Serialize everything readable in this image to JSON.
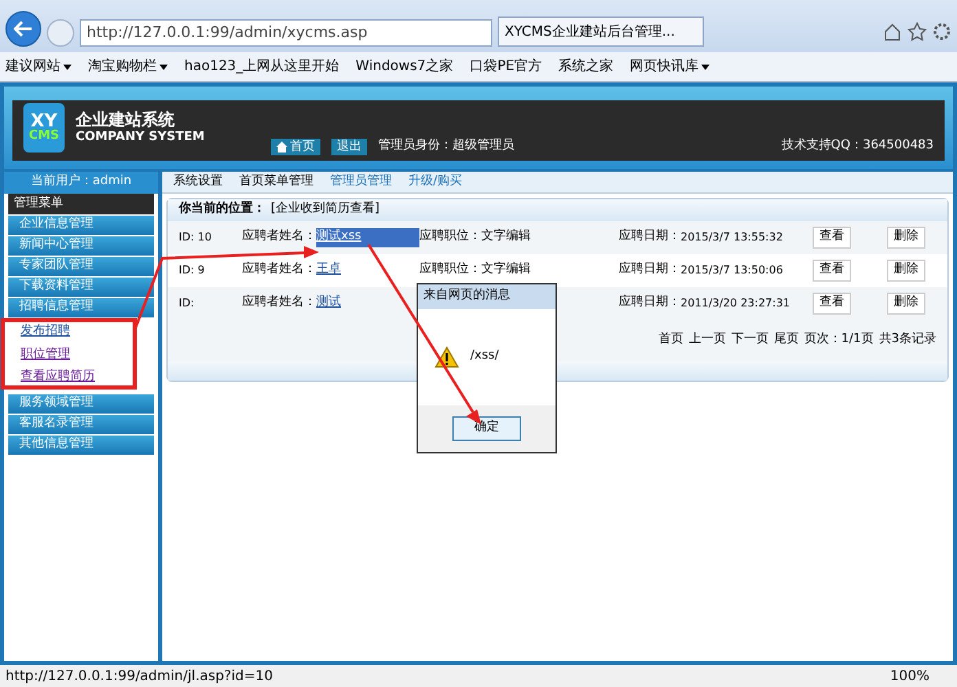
{
  "browser": {
    "address": "http://127.0.0.1:99/admin/xycms.asp",
    "tab_title": "XYCMS企业建站后台管理...",
    "bookmarks": [
      {
        "label": "建议网站",
        "dropdown": true
      },
      {
        "label": "淘宝购物栏",
        "dropdown": true
      },
      {
        "label": "hao123_上网从这里开始",
        "dropdown": false
      },
      {
        "label": "Windows7之家",
        "dropdown": false
      },
      {
        "label": "口袋PE官方",
        "dropdown": false
      },
      {
        "label": "系统之家",
        "dropdown": false
      },
      {
        "label": "网页快讯库",
        "dropdown": true
      }
    ]
  },
  "header": {
    "logo_top": "XY",
    "logo_bottom": "CMS",
    "title": "企业建站系统",
    "subtitle": "COMPANY SYSTEM",
    "home": "首页",
    "logout": "退出",
    "role": "管理员身份：超级管理员",
    "support": "技术支持QQ：364500483"
  },
  "user": "当前用户：admin",
  "top_menu": [
    {
      "label": "系统设置",
      "link": false
    },
    {
      "label": "首页菜单管理",
      "link": false
    },
    {
      "label": "管理员管理",
      "link": true
    },
    {
      "label": "升级/购买",
      "link": true
    }
  ],
  "sidebar": {
    "title": "管理菜单",
    "items": [
      {
        "label": "企业信息管理"
      },
      {
        "label": "新闻中心管理"
      },
      {
        "label": "专家团队管理"
      },
      {
        "label": "下载资料管理"
      },
      {
        "label": "招聘信息管理",
        "children": [
          {
            "label": "发布招聘",
            "visited": false
          },
          {
            "label": "职位管理",
            "visited": true
          },
          {
            "label": "查看应聘简历",
            "visited": true
          }
        ]
      },
      {
        "label": "服务领域管理"
      },
      {
        "label": "客服名录管理"
      },
      {
        "label": "其他信息管理"
      }
    ]
  },
  "location": {
    "label": "你当前的位置：",
    "value": "[企业收到简历查看]"
  },
  "rows": [
    {
      "id": "ID: 10",
      "name_label": "应聘者姓名：",
      "name": "测试xss",
      "selected": true,
      "job": "应聘职位：文字编辑",
      "date_label": "应聘日期：",
      "date": "2015/3/7 13:55:32",
      "view": "查看",
      "delete": "删除"
    },
    {
      "id": "ID: 9",
      "name_label": "应聘者姓名：",
      "name": "王卓",
      "selected": false,
      "job": "应聘职位：文字编辑",
      "date_label": "应聘日期：",
      "date": "2015/3/7 13:50:06",
      "view": "查看",
      "delete": "删除"
    },
    {
      "id": "ID:",
      "name_label": "应聘者姓名：",
      "name": "测试",
      "selected": false,
      "date_label": "应聘日期：",
      "date": "2011/3/20 23:27:31",
      "view": "查看",
      "delete": "删除"
    }
  ],
  "pager": [
    "首页",
    "上一页",
    "下一页",
    "尾页",
    "页次：1/1页",
    "共3条记录"
  ],
  "dialog": {
    "title": "来自网页的消息",
    "message": "/xss/",
    "ok": "确定"
  },
  "status_bar": {
    "url": "http://127.0.0.1:99/admin/jl.asp?id=10",
    "zoom": "100%"
  }
}
